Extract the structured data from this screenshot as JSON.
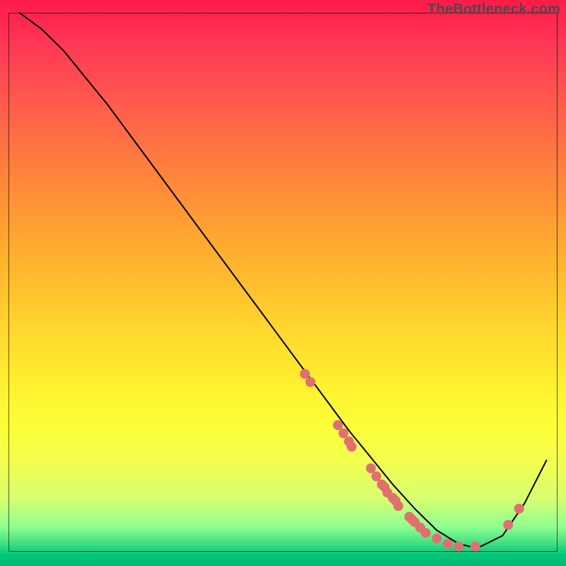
{
  "watermark": "TheBottleneck.com",
  "chart_data": {
    "type": "line",
    "title": "",
    "xlabel": "",
    "ylabel": "",
    "xlim": [
      0,
      100
    ],
    "ylim": [
      0,
      100
    ],
    "grid": false,
    "legend": false,
    "series": [
      {
        "name": "curve",
        "color": "#000000",
        "x": [
          2,
          6,
          10,
          14,
          18,
          22,
          26,
          30,
          34,
          38,
          42,
          46,
          50,
          54,
          58,
          62,
          66,
          70,
          74,
          78,
          82,
          84,
          86,
          90,
          94,
          98
        ],
        "y": [
          100,
          97,
          93,
          88,
          83,
          77.5,
          72,
          66.5,
          61,
          55.5,
          50,
          44.5,
          39,
          33.5,
          28,
          22.5,
          17.5,
          12.5,
          8,
          4,
          1.5,
          1,
          1,
          3,
          9,
          17
        ]
      }
    ],
    "scatter_points": {
      "name": "dots",
      "color": "#e07070",
      "radius": 7,
      "points": [
        {
          "x": 54,
          "y": 33
        },
        {
          "x": 55,
          "y": 31.5
        },
        {
          "x": 60,
          "y": 23.5
        },
        {
          "x": 61,
          "y": 22
        },
        {
          "x": 62,
          "y": 20.5
        },
        {
          "x": 62.5,
          "y": 19.5
        },
        {
          "x": 66,
          "y": 15.5
        },
        {
          "x": 67,
          "y": 14
        },
        {
          "x": 68,
          "y": 12.5
        },
        {
          "x": 68.5,
          "y": 12
        },
        {
          "x": 69,
          "y": 11
        },
        {
          "x": 70,
          "y": 10
        },
        {
          "x": 70.5,
          "y": 9.5
        },
        {
          "x": 71,
          "y": 8.5
        },
        {
          "x": 73,
          "y": 6.5
        },
        {
          "x": 73.5,
          "y": 6
        },
        {
          "x": 74,
          "y": 5.5
        },
        {
          "x": 75,
          "y": 4.5
        },
        {
          "x": 76,
          "y": 3.5
        },
        {
          "x": 78,
          "y": 2.5
        },
        {
          "x": 80,
          "y": 1.5
        },
        {
          "x": 82,
          "y": 1
        },
        {
          "x": 85,
          "y": 1
        },
        {
          "x": 91,
          "y": 5
        },
        {
          "x": 93,
          "y": 8
        }
      ]
    }
  }
}
